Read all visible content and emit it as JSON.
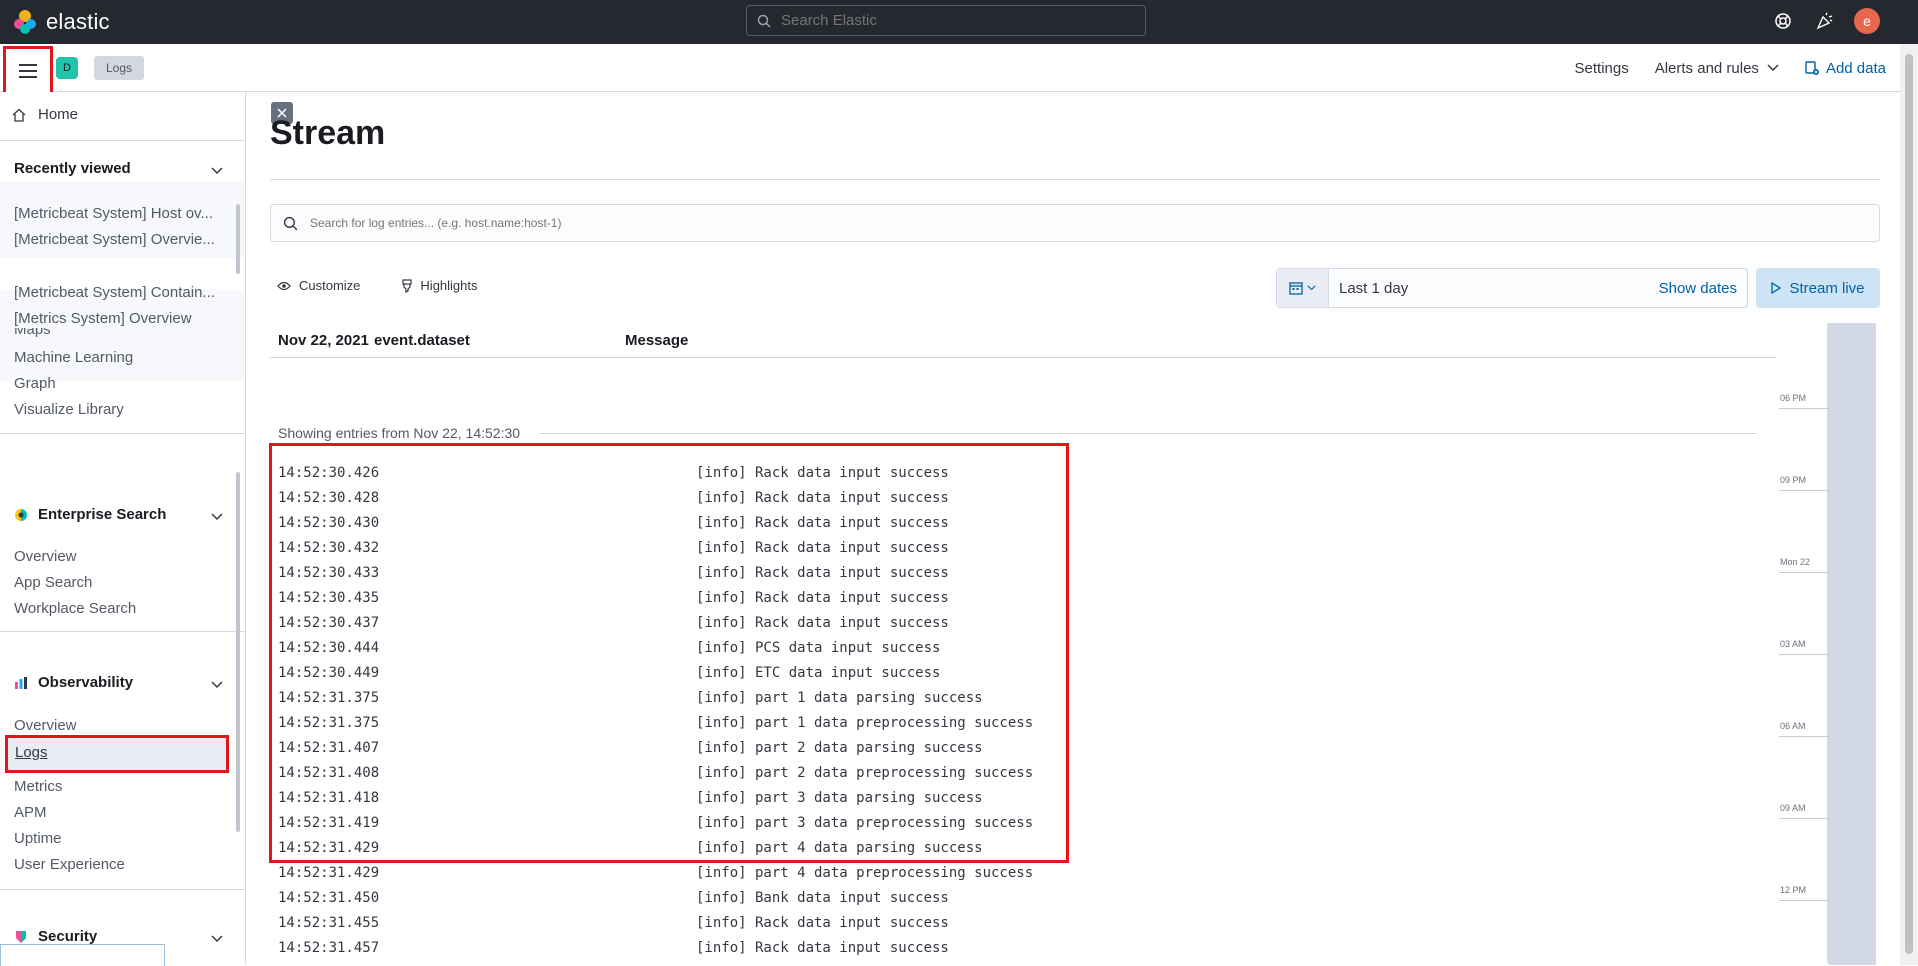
{
  "header": {
    "brand": "elastic",
    "search_placeholder": "Search Elastic",
    "avatar_initial": "e"
  },
  "subheader": {
    "space_initial": "D",
    "breadcrumb": "Logs",
    "settings": "Settings",
    "alerts": "Alerts and rules",
    "add_data": "Add data"
  },
  "sidebar": {
    "home": "Home",
    "recently_viewed": {
      "title": "Recently viewed",
      "items": [
        "[Metricbeat System] Host ov...",
        "[Metricbeat System] Overvie...",
        "[Metricbeat System] Contain...",
        "[Metrics System] Overview"
      ]
    },
    "analytics_items": [
      "Maps",
      "Machine Learning",
      "Graph",
      "Visualize Library"
    ],
    "enterprise_search": {
      "title": "Enterprise Search",
      "items": [
        "Overview",
        "App Search",
        "Workplace Search"
      ]
    },
    "observability": {
      "title": "Observability",
      "items": [
        "Overview",
        "Logs",
        "Metrics",
        "APM",
        "Uptime",
        "User Experience"
      ]
    },
    "security": {
      "title": "Security"
    }
  },
  "main": {
    "title": "Stream",
    "search_placeholder": "Search for log entries... (e.g. host.name:host-1)",
    "customize": "Customize",
    "highlights": "Highlights",
    "date_range": "Last 1 day",
    "show_dates": "Show dates",
    "stream_live": "Stream live",
    "columns": {
      "date": "Nov 22, 2021",
      "dataset": "event.dataset",
      "message": "Message"
    },
    "showing": "Showing entries from Nov 22, 14:52:30",
    "rows": [
      {
        "ts": "14:52:30.426",
        "msg": "[info] Rack data input success"
      },
      {
        "ts": "14:52:30.428",
        "msg": "[info] Rack data input success"
      },
      {
        "ts": "14:52:30.430",
        "msg": "[info] Rack data input success"
      },
      {
        "ts": "14:52:30.432",
        "msg": "[info] Rack data input success"
      },
      {
        "ts": "14:52:30.433",
        "msg": "[info] Rack data input success"
      },
      {
        "ts": "14:52:30.435",
        "msg": "[info] Rack data input success"
      },
      {
        "ts": "14:52:30.437",
        "msg": "[info] Rack data input success"
      },
      {
        "ts": "14:52:30.444",
        "msg": "[info] PCS data input success"
      },
      {
        "ts": "14:52:30.449",
        "msg": "[info] ETC data input success"
      },
      {
        "ts": "14:52:31.375",
        "msg": "[info] part 1 data parsing success"
      },
      {
        "ts": "14:52:31.375",
        "msg": "[info] part 1 data preprocessing success"
      },
      {
        "ts": "14:52:31.407",
        "msg": "[info] part 2 data parsing success"
      },
      {
        "ts": "14:52:31.408",
        "msg": "[info] part 2 data preprocessing success"
      },
      {
        "ts": "14:52:31.418",
        "msg": "[info] part 3 data parsing success"
      },
      {
        "ts": "14:52:31.419",
        "msg": "[info] part 3 data preprocessing success"
      },
      {
        "ts": "14:52:31.429",
        "msg": "[info] part 4 data parsing success"
      },
      {
        "ts": "14:52:31.429",
        "msg": "[info] part 4 data preprocessing success"
      },
      {
        "ts": "14:52:31.450",
        "msg": "[info] Bank data input success"
      },
      {
        "ts": "14:52:31.455",
        "msg": "[info] Rack data input success"
      },
      {
        "ts": "14:52:31.457",
        "msg": "[info] Rack data input success"
      }
    ],
    "minimap_labels": [
      "06 PM",
      "09 PM",
      "Mon 22",
      "03 AM",
      "06 AM",
      "09 AM",
      "12 PM"
    ]
  },
  "colors": {
    "header_bg": "#25282f",
    "accent_blue": "#0061a6",
    "highlight_red": "#e0171d"
  }
}
